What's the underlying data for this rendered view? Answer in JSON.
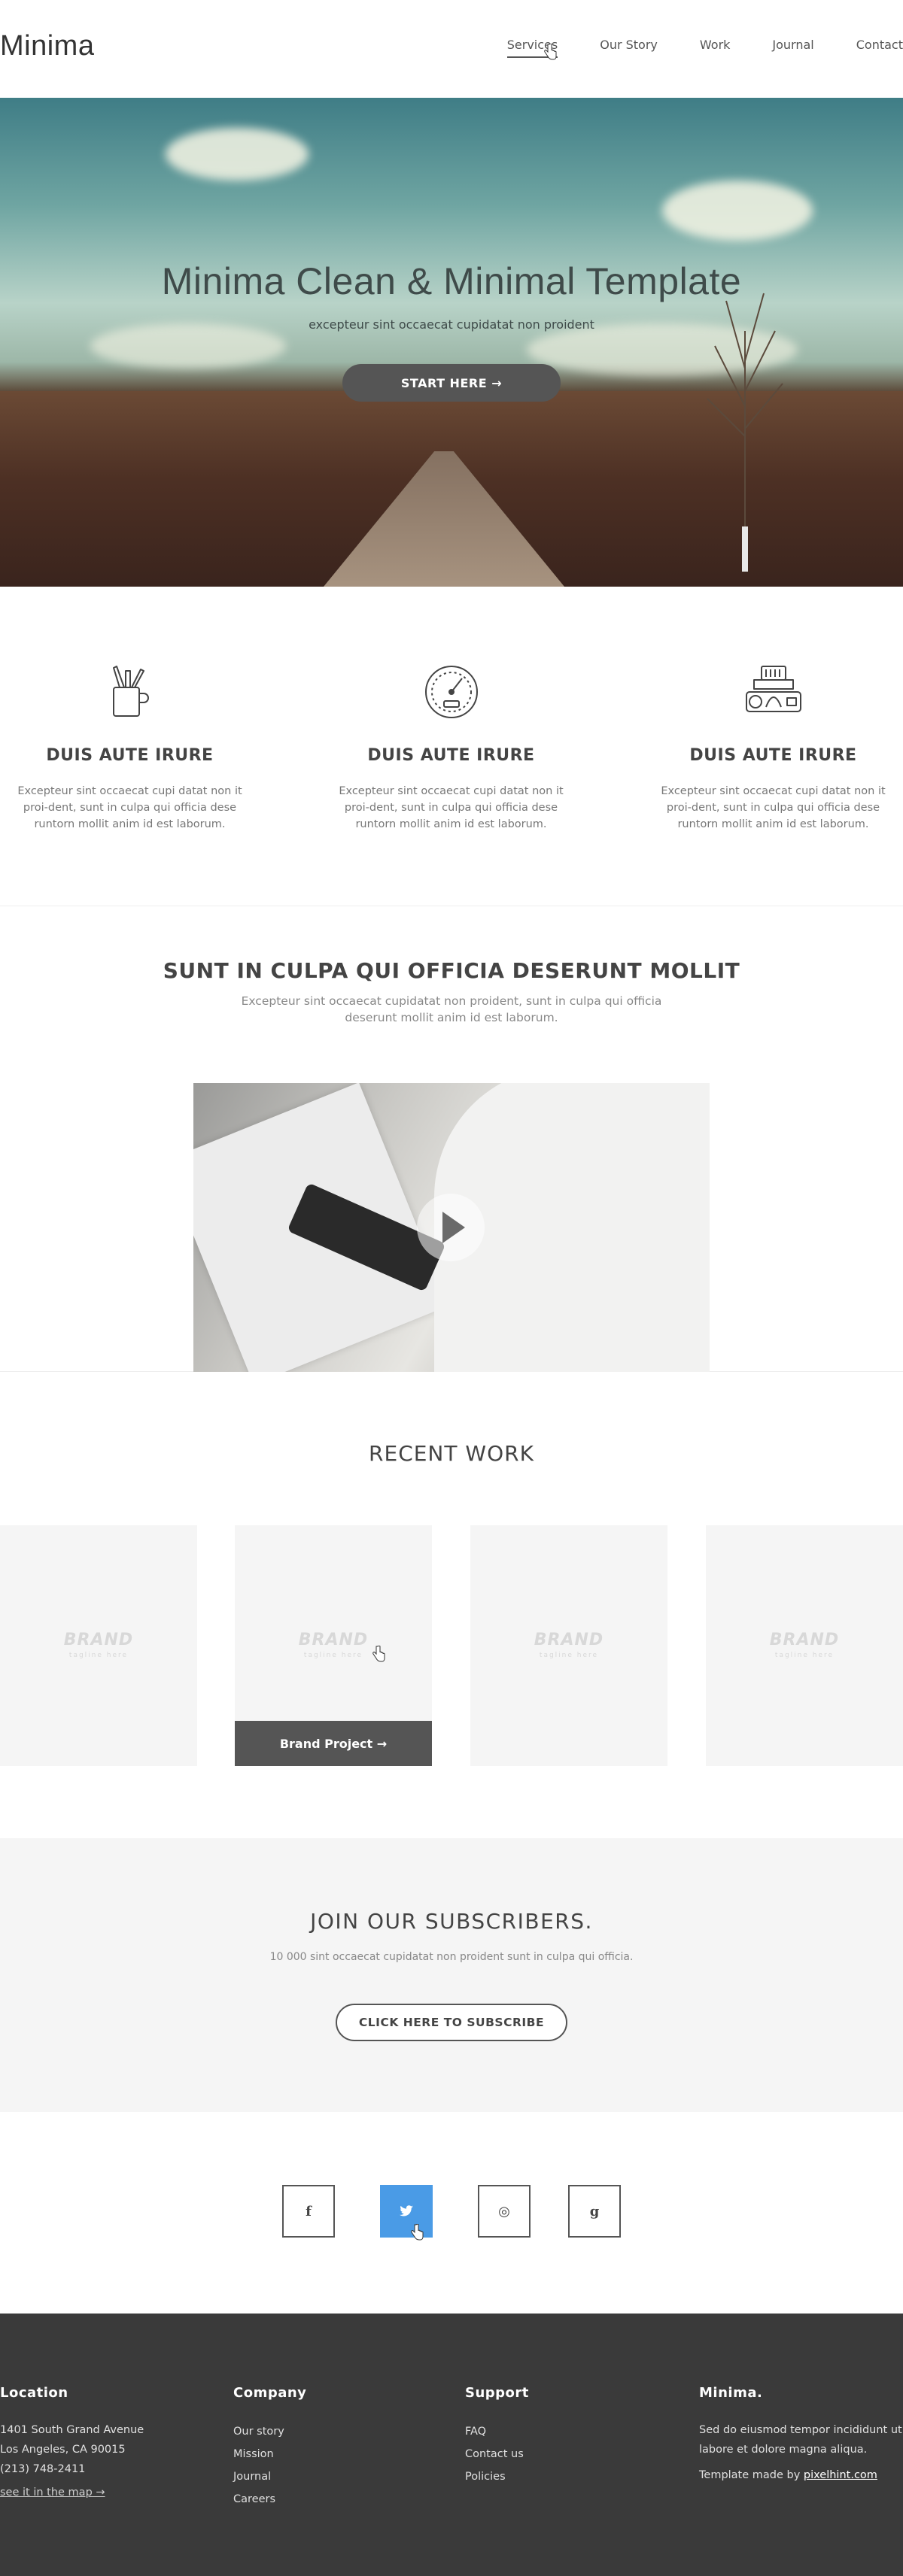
{
  "header": {
    "logo": "Minima",
    "nav": [
      "Services",
      "Our Story",
      "Work",
      "Journal",
      "Contact"
    ],
    "active_nav": "Services"
  },
  "hero": {
    "title": "Minima Clean & Minimal Template",
    "subtitle": "excepteur sint occaecat cupidatat non proident",
    "button": "START HERE →"
  },
  "features": [
    {
      "icon": "pencil-cup-icon",
      "title": "DUIS AUTE IRURE",
      "text": "Excepteur sint occaecat cupi datat non it proi-dent, sunt in culpa qui officia dese runtorn mollit anim id est laborum."
    },
    {
      "icon": "speedometer-icon",
      "title": "DUIS AUTE IRURE",
      "text": "Excepteur sint occaecat cupi datat non it proi-dent, sunt in culpa qui officia dese runtorn mollit anim id est laborum."
    },
    {
      "icon": "camera-icon",
      "title": "DUIS AUTE IRURE",
      "text": "Excepteur sint occaecat cupi datat non it proi-dent, sunt in culpa qui officia dese runtorn mollit anim id est laborum."
    }
  ],
  "video_section": {
    "title": "SUNT IN CULPA QUI OFFICIA DESERUNT MOLLIT",
    "text": "Excepteur sint occaecat cupidatat non proident, sunt in culpa qui officia deserunt mollit anim id est laborum."
  },
  "recent_work": {
    "title": "RECENT WORK",
    "cards": [
      {
        "brand": "BRAND",
        "tagline": "tagline here"
      },
      {
        "brand": "BRAND",
        "tagline": "tagline here",
        "overlay": "Brand Project →"
      },
      {
        "brand": "BRAND",
        "tagline": "tagline here"
      },
      {
        "brand": "BRAND",
        "tagline": "tagline here"
      }
    ]
  },
  "subscribe": {
    "title": "JOIN OUR SUBSCRIBERS.",
    "text": "10 000 sint occaecat cupidatat non proident sunt in culpa qui officia.",
    "button": "CLICK HERE TO SUBSCRIBE"
  },
  "social": [
    {
      "icon": "facebook-icon",
      "glyph": "f"
    },
    {
      "icon": "twitter-icon",
      "glyph": "🐦"
    },
    {
      "icon": "dribbble-icon",
      "glyph": "◎"
    },
    {
      "icon": "google-icon",
      "glyph": "g"
    }
  ],
  "footer": {
    "location": {
      "title": "Location",
      "lines": [
        "1401 South Grand Avenue",
        "Los Angeles, CA 90015",
        "(213) 748-2411"
      ],
      "map_link": "see it in the map →"
    },
    "company": {
      "title": "Company",
      "links": [
        "Our story",
        "Mission",
        "Journal",
        "Careers"
      ]
    },
    "support": {
      "title": "Support",
      "links": [
        "FAQ",
        "Contact us",
        "Policies"
      ]
    },
    "about": {
      "title": "Minima.",
      "text": "Sed do eiusmod tempor incididunt ut labore et dolore magna aliqua.",
      "credit_prefix": "Template made by ",
      "credit_link": "pixelhint.com"
    }
  },
  "colors": {
    "accent_dark": "#555555",
    "twitter_active": "#4a9be6",
    "footer_bg": "#3a3a3a"
  }
}
